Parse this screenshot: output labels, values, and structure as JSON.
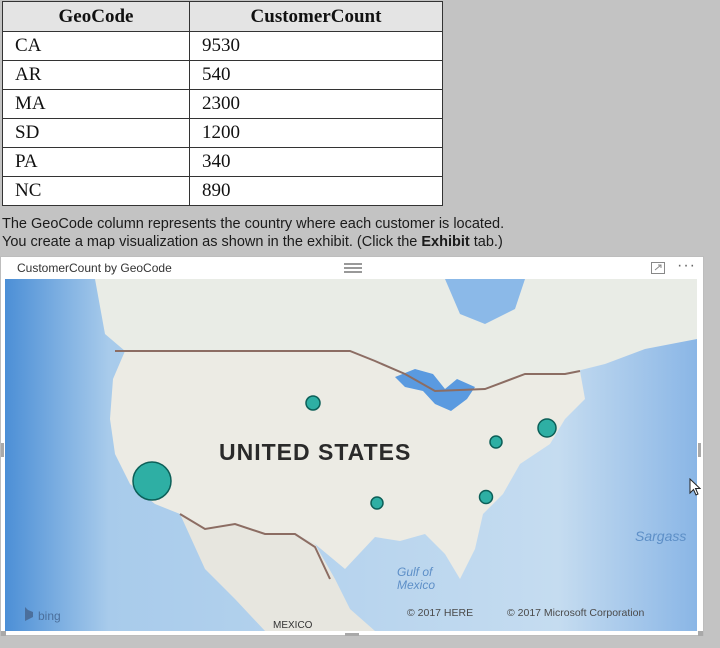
{
  "table": {
    "headers": [
      "GeoCode",
      "CustomerCount"
    ],
    "rows": [
      [
        "CA",
        "9530"
      ],
      [
        "AR",
        "540"
      ],
      [
        "MA",
        "2300"
      ],
      [
        "SD",
        "1200"
      ],
      [
        "PA",
        "340"
      ],
      [
        "NC",
        "890"
      ]
    ]
  },
  "captions": {
    "line1": "The GeoCode column represents the country where each customer is located.",
    "line2_before": "You create a map visualization as shown in the exhibit. (Click the ",
    "line2_bold": "Exhibit",
    "line2_after": " tab.)"
  },
  "visual": {
    "title": "CustomerCount by GeoCode",
    "more_label": "···"
  },
  "map": {
    "country_label": "UNITED STATES",
    "gulf_label_1": "Gulf of",
    "gulf_label_2": "Mexico",
    "sea_label": "Sargass",
    "mexico_label": "MEXICO",
    "bing_label": "bing",
    "here_credit": "© 2017 HERE",
    "ms_credit": "© 2017 Microsoft Corporation",
    "bubble_color": "#1aa99c"
  }
}
